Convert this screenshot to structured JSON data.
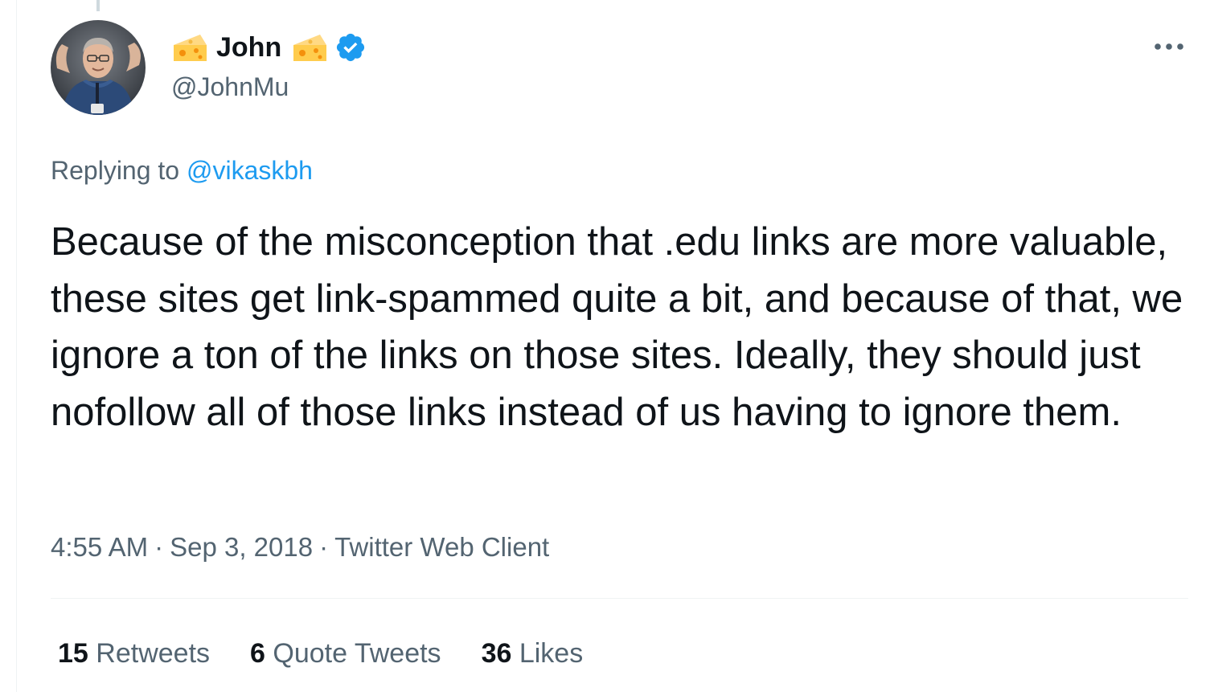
{
  "tweet": {
    "author": {
      "display_name": "John",
      "handle": "@JohnMu",
      "verified": true,
      "name_emoji": "cheese-wedge-icon",
      "avatar": "profile photo of man in blue shirt with lanyard"
    },
    "replying_to": {
      "prefix": "Replying to",
      "handle": "@vikaskbh"
    },
    "text": "Because of the misconception that .edu links are more valuable, these sites get link-spammed quite a bit, and because of that, we ignore a ton of the links on those sites. Ideally, they should just nofollow all of those links instead of us having to ignore them.",
    "time": "4:55 AM",
    "date": "Sep 3, 2018",
    "separator": "·",
    "source": "Twitter Web Client",
    "stats": {
      "retweets_count": "15",
      "retweets_label": "Retweets",
      "quotes_count": "6",
      "quotes_label": "Quote Tweets",
      "likes_count": "36",
      "likes_label": "Likes"
    }
  },
  "colors": {
    "link_blue": "#1d9bf0",
    "text_primary": "#0f1419",
    "text_secondary": "#536471",
    "divider": "#eff3f4"
  },
  "icons": {
    "more": "more-horizontal-icon",
    "verified": "verified-badge-icon"
  }
}
